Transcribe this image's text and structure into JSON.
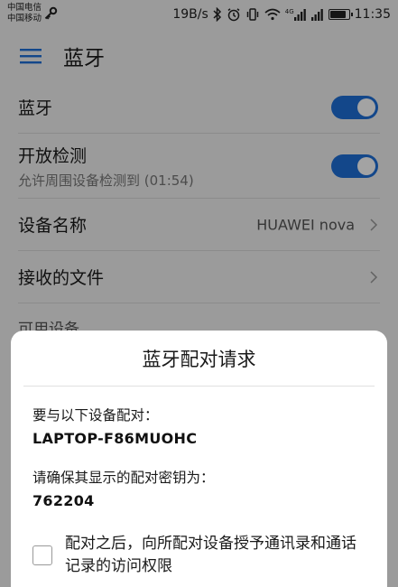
{
  "status_bar": {
    "carrier_1": "中国电信",
    "carrier_2": "中国移动",
    "net_speed": "19B/s",
    "network_type": "4G",
    "time": "11:35",
    "battery_level": 0.85
  },
  "header": {
    "title": "蓝牙"
  },
  "settings": {
    "bluetooth": {
      "label": "蓝牙",
      "enabled": true
    },
    "discoverable": {
      "label": "开放检测",
      "sub": "允许周围设备检测到 (01:54)",
      "enabled": true
    },
    "device_name": {
      "label": "设备名称",
      "value": "HUAWEI nova"
    },
    "received_files": {
      "label": "接收的文件"
    },
    "available_devices_header": "可用设备"
  },
  "dialog": {
    "title": "蓝牙配对请求",
    "pair_with_label": "要与以下设备配对：",
    "device": "LAPTOP-F86MUOHC",
    "key_label": "请确保其显示的配对密钥为：",
    "key": "762204",
    "consent_text": "配对之后，向所配对设备授予通讯录和通话记录的访问权限",
    "consent_checked": false
  },
  "colors": {
    "accent": "#1f6fd8",
    "background": "#f2f2f2"
  }
}
